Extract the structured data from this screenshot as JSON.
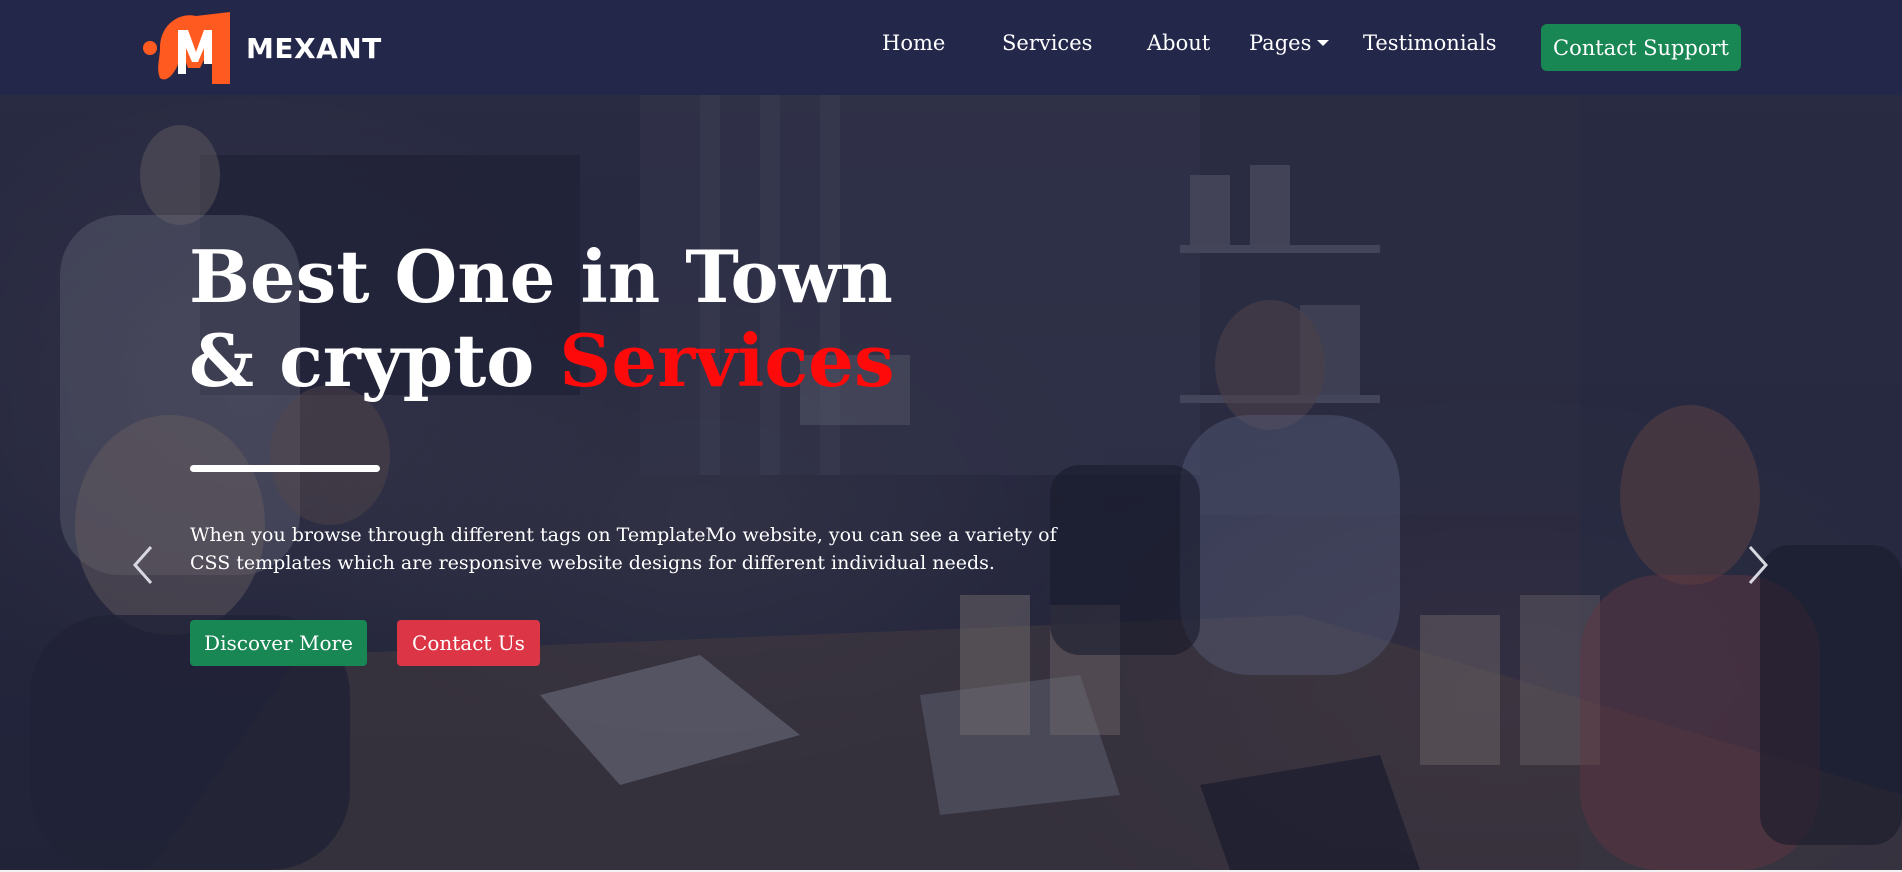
{
  "brand": {
    "name": "MEXANT",
    "logo_color": "#ff5a1f"
  },
  "nav": {
    "items": [
      {
        "label": "Home"
      },
      {
        "label": "Services"
      },
      {
        "label": "About"
      },
      {
        "label": "Pages"
      },
      {
        "label": "Testimonials"
      }
    ],
    "cta_label": "Contact Support",
    "cta_color": "#198754",
    "background": "#23274a"
  },
  "hero": {
    "title_line1": "Best One in Town",
    "title_line2_prefix": "& crypto",
    "title_line2_accent": "Services",
    "accent_color": "#ff0a0a",
    "description": "When you browse through different tags on TemplateMo website, you can see a variety of CSS templates which are responsive website designs for different individual needs.",
    "primary_button": "Discover More",
    "secondary_button": "Contact Us",
    "primary_color": "#198754",
    "secondary_color": "#dc3545",
    "prev_icon": "chevron-left-icon",
    "next_icon": "chevron-right-icon"
  }
}
